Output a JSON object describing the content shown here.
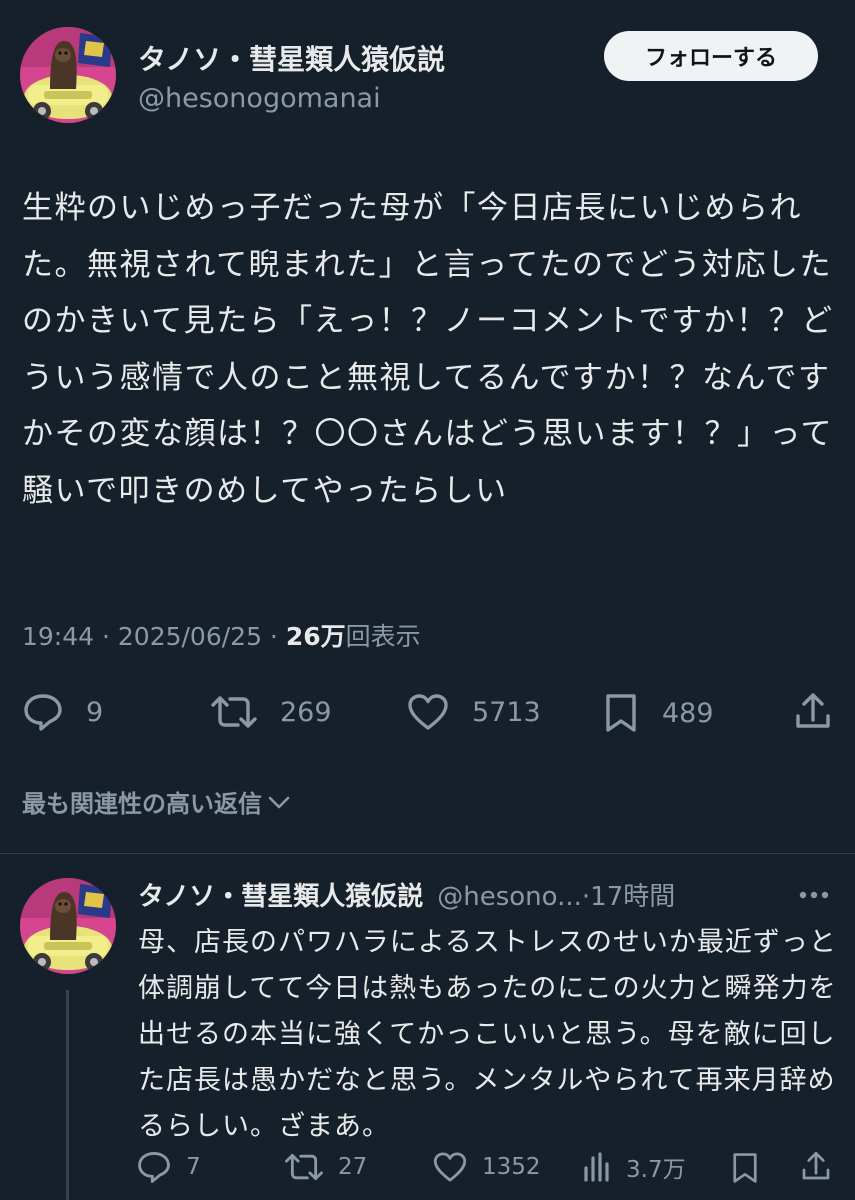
{
  "post": {
    "author_name": "タノソ・彗星類人猿仮説",
    "author_handle": "@hesonogomanai",
    "follow_label": "フォローする",
    "text": "生粋のいじめっ子だった母が「今日店長にいじめられた。無視されて睨まれた」と言ってたのでどう対応したのかきいて見たら「えっ！？ノーコメントですか！？どういう感情で人のこと無視してるんですか！？なんですかその変な顔は！？〇〇さんはどう思います！？」って騒いで叩きのめしてやったらしい",
    "time": "19:44",
    "date": "2025/06/25",
    "separator": " · ",
    "views_count": "26万",
    "views_label": "回表示",
    "stats": {
      "replies": "9",
      "reposts": "269",
      "likes": "5713",
      "bookmarks": "489"
    }
  },
  "replies_section": {
    "sort_label": "最も関連性の高い返信"
  },
  "reply": {
    "author_name": "タノソ・彗星類人猿仮説",
    "author_handle": "@hesono...",
    "time": "·17時間",
    "text": "母、店長のパワハラによるストレスのせいか最近ずっと体調崩してて今日は熱もあったのにこの火力と瞬発力を出せるの本当に強くてかっこいいと思う。母を敵に回した店長は愚かだなと思う。メンタルやられて再来月辞めるらしい。ざまあ。",
    "stats": {
      "replies": "7",
      "reposts": "27",
      "likes": "1352",
      "views": "3.7万"
    }
  },
  "icons": {
    "reply": "speech-bubble-icon",
    "repost": "repost-arrows-icon",
    "like": "heart-icon",
    "bookmark": "bookmark-icon",
    "share": "share-upload-icon",
    "views": "bar-chart-icon",
    "more": "more-dots-icon",
    "chevron": "chevron-down-icon"
  },
  "colors": {
    "background": "#15202b",
    "text": "#e7e9ea",
    "muted": "#8b98a5",
    "button_bg": "#eff3f4"
  }
}
